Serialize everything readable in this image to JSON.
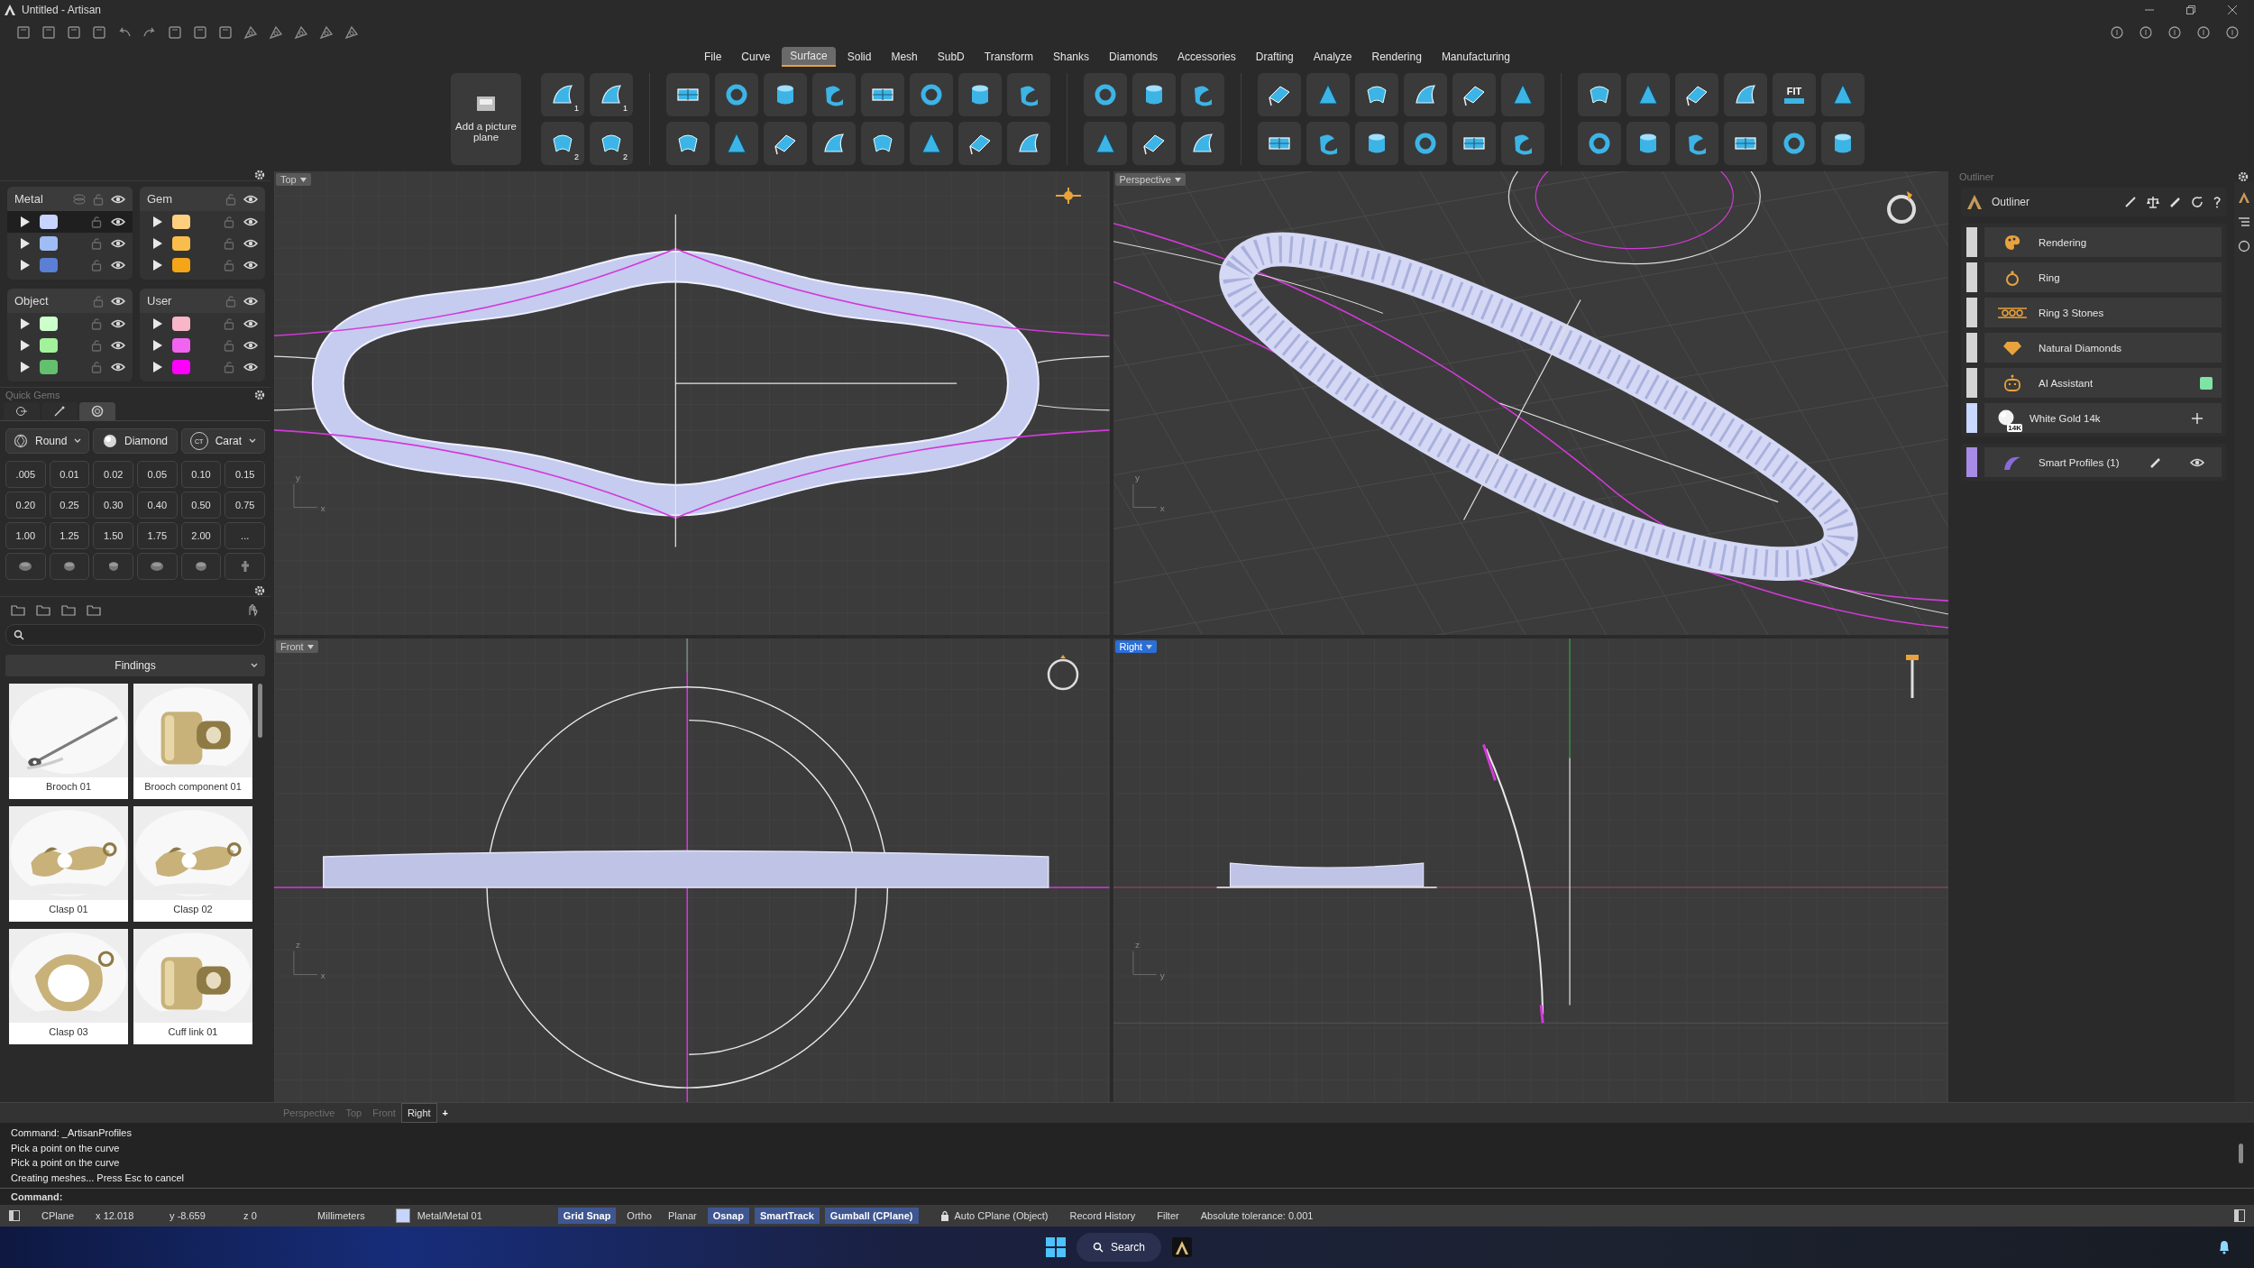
{
  "window": {
    "title": "Untitled - Artisan"
  },
  "menu": [
    {
      "label": "File",
      "selected": false
    },
    {
      "label": "Curve",
      "selected": false
    },
    {
      "label": "Surface",
      "selected": true
    },
    {
      "label": "Solid",
      "selected": false
    },
    {
      "label": "Mesh",
      "selected": false
    },
    {
      "label": "SubD",
      "selected": false
    },
    {
      "label": "Transform",
      "selected": false
    },
    {
      "label": "Shanks",
      "selected": false
    },
    {
      "label": "Diamonds",
      "selected": false
    },
    {
      "label": "Accessories",
      "selected": false
    },
    {
      "label": "Drafting",
      "selected": false
    },
    {
      "label": "Analyze",
      "selected": false
    },
    {
      "label": "Rendering",
      "selected": false
    },
    {
      "label": "Manufacturing",
      "selected": false
    }
  ],
  "ribbon": {
    "picture_button": "Add a picture plane",
    "badges": [
      "1",
      "2",
      "1",
      "2"
    ],
    "fit_label": "FIT"
  },
  "layers": [
    {
      "name": "Metal",
      "rows": [
        {
          "color": "#c6d4ff",
          "selected": true
        },
        {
          "color": "#9fbcf5",
          "selected": false
        },
        {
          "color": "#5a7fd4",
          "selected": false
        }
      ]
    },
    {
      "name": "Gem",
      "rows": [
        {
          "color": "#ffcf80",
          "selected": false
        },
        {
          "color": "#f9bd4c",
          "selected": false
        },
        {
          "color": "#f5a518",
          "selected": false
        }
      ]
    },
    {
      "name": "Object",
      "rows": [
        {
          "color": "#ccffcc",
          "selected": false
        },
        {
          "color": "#a2f29c",
          "selected": false
        },
        {
          "color": "#64c06e",
          "selected": false
        }
      ]
    },
    {
      "name": "User",
      "rows": [
        {
          "color": "#f8b6c8",
          "selected": false
        },
        {
          "color": "#f064f0",
          "selected": false
        },
        {
          "color": "#ff00ff",
          "selected": false
        }
      ]
    }
  ],
  "quick_gems": {
    "title": "Quick Gems",
    "tabs": [
      {
        "selected": false
      },
      {
        "selected": false
      },
      {
        "selected": true
      }
    ],
    "dropdowns": [
      {
        "kind": "cut",
        "label": "Round",
        "has_menu": true
      },
      {
        "kind": "material",
        "label": "Diamond",
        "has_menu": false
      },
      {
        "kind": "unit",
        "label": "Carat",
        "icon_text": "CT",
        "has_menu": true
      }
    ],
    "sizes": [
      ".005",
      "0.01",
      "0.02",
      "0.05",
      "0.10",
      "0.15",
      "0.20",
      "0.25",
      "0.30",
      "0.40",
      "0.50",
      "0.75",
      "1.00",
      "1.25",
      "1.50",
      "1.75",
      "2.00",
      "..."
    ]
  },
  "library": {
    "category": "Findings",
    "items": [
      {
        "label": "Brooch 01",
        "kind": "pin"
      },
      {
        "label": "Brooch component 01",
        "kind": "barrel"
      },
      {
        "label": "Clasp 01",
        "kind": "clasp"
      },
      {
        "label": "Clasp 02",
        "kind": "clasp"
      },
      {
        "label": "Clasp 03",
        "kind": "loop"
      },
      {
        "label": "Cuff link 01",
        "kind": "barrel"
      }
    ]
  },
  "viewports": [
    {
      "label": "Top",
      "selected": false,
      "kind": "top",
      "axes": [
        "y",
        "x"
      ]
    },
    {
      "label": "Perspective",
      "selected": false,
      "kind": "perspective",
      "axes": [
        "y",
        "x"
      ]
    },
    {
      "label": "Front",
      "selected": false,
      "kind": "front",
      "axes": [
        "z",
        "x"
      ]
    },
    {
      "label": "Right",
      "selected": true,
      "kind": "right",
      "axes": [
        "z",
        "y"
      ]
    }
  ],
  "view_tabs": {
    "tabs": [
      {
        "label": "Perspective",
        "selected": false
      },
      {
        "label": "Top",
        "selected": false
      },
      {
        "label": "Front",
        "selected": false
      },
      {
        "label": "Right",
        "selected": true
      }
    ],
    "add": "+"
  },
  "command": {
    "history": [
      "Command: _ArtisanProfiles",
      "Pick a point on the curve",
      "Pick a point on the curve",
      "Creating meshes... Press Esc to cancel"
    ],
    "prompt": "Command:"
  },
  "status_bar": {
    "items": [
      {
        "kind": "text",
        "label": "CPlane"
      },
      {
        "kind": "text",
        "label": "x 12.018"
      },
      {
        "kind": "text",
        "label": "y -8.659"
      },
      {
        "kind": "text",
        "label": "z 0"
      },
      {
        "kind": "text",
        "label": "Millimeters"
      },
      {
        "kind": "layer",
        "label": "Metal/Metal 01",
        "color": "#c6d4ff"
      },
      {
        "kind": "toggle",
        "label": "Grid Snap",
        "on": true
      },
      {
        "kind": "toggle",
        "label": "Ortho",
        "on": false
      },
      {
        "kind": "toggle",
        "label": "Planar",
        "on": false
      },
      {
        "kind": "toggle",
        "label": "Osnap",
        "on": true
      },
      {
        "kind": "toggle",
        "label": "SmartTrack",
        "on": true
      },
      {
        "kind": "toggle",
        "label": "Gumball (CPlane)",
        "on": true
      },
      {
        "kind": "locked",
        "label": "Auto CPlane (Object)"
      },
      {
        "kind": "text",
        "label": "Record History"
      },
      {
        "kind": "text",
        "label": "Filter"
      },
      {
        "kind": "text",
        "label": "Absolute tolerance: 0.001"
      }
    ]
  },
  "outliner": {
    "panel_title": "Outliner",
    "title": "Outliner",
    "items": [
      {
        "label": "Rendering",
        "kind": "palette",
        "color": "#d4d4d4"
      },
      {
        "label": "Ring",
        "kind": "ring",
        "color": "#d4d4d4"
      },
      {
        "label": "Ring 3 Stones",
        "kind": "stones",
        "color": "#d4d4d4"
      },
      {
        "label": "Natural Diamonds",
        "kind": "diamond",
        "color": "#d4d4d4"
      },
      {
        "label": "AI Assistant",
        "kind": "robot",
        "color": "#d4d4d4",
        "badge": {
          "color": "#7fe3a6"
        }
      },
      {
        "label": "White Gold 14k",
        "kind": "metal",
        "color": "#c8d8ff",
        "icon_text": "14K",
        "addable": true
      }
    ],
    "profiles": {
      "label": "Smart Profiles (1)",
      "color": "#a78be6"
    }
  },
  "taskbar": {
    "search": "Search"
  }
}
